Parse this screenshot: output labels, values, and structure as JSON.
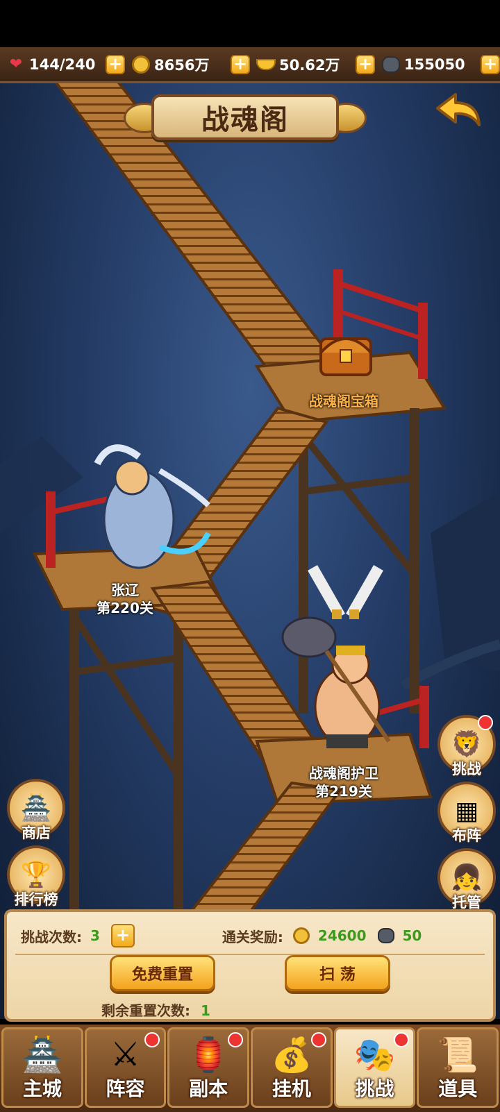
{
  "resources": [
    {
      "icon": "heart-icon",
      "value": "144/240"
    },
    {
      "icon": "coin-icon",
      "value": "8656万"
    },
    {
      "icon": "gold-ingot-icon",
      "value": "50.62万"
    },
    {
      "icon": "ore-icon",
      "value": "155050"
    }
  ],
  "title": "战魂阁",
  "chest": {
    "label": "战魂阁宝箱"
  },
  "stages": [
    {
      "name": "张辽",
      "level": "第220关"
    },
    {
      "name": "战魂阁护卫",
      "level": "第219关"
    }
  ],
  "left_buttons": [
    {
      "icon": "shop-icon",
      "label": "商店"
    },
    {
      "icon": "ranking-icon",
      "label": "排行榜"
    }
  ],
  "right_buttons": [
    {
      "icon": "challenge-icon",
      "label": "挑战",
      "badge": true
    },
    {
      "icon": "formation-icon",
      "label": "布阵",
      "badge": false
    },
    {
      "icon": "auto-icon",
      "label": "托管",
      "badge": false
    }
  ],
  "panel": {
    "challenge_label": "挑战次数:",
    "challenge_count": "3",
    "reward_label": "通关奖励:",
    "reward_coin": "24600",
    "reward_ore": "50",
    "free_reset_button": "免费重置",
    "sweep_button": "扫 荡",
    "remaining_reset_label": "剩余重置次数:",
    "remaining_reset_count": "1"
  },
  "nav": [
    {
      "icon": "main-city-icon",
      "label": "主城",
      "badge": false,
      "active": false
    },
    {
      "icon": "lineup-icon",
      "label": "阵容",
      "badge": true,
      "active": false
    },
    {
      "icon": "dungeon-icon",
      "label": "副本",
      "badge": true,
      "active": false
    },
    {
      "icon": "idle-icon",
      "label": "挂机",
      "badge": true,
      "active": false
    },
    {
      "icon": "challenge-tab-icon",
      "label": "挑战",
      "badge": true,
      "active": true
    },
    {
      "icon": "items-icon",
      "label": "道具",
      "badge": false,
      "active": false
    }
  ]
}
